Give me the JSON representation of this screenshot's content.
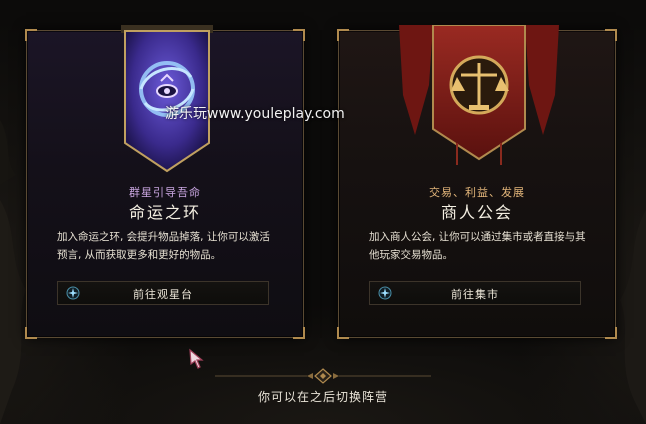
{
  "watermark": "游乐玩www.youleplay.com",
  "cards": [
    {
      "subtitle": "群星引导吾命",
      "title": "命运之环",
      "description": "加入命运之环, 会提升物品掉落, 让你可以激活预言, 从而获取更多和更好的物品。",
      "button_label": "前往观星台",
      "banner_icon": "eye-swirl-emblem-icon",
      "button_icon": "compass-star-icon",
      "accent": "#c9a6e0"
    },
    {
      "subtitle": "交易、利益、发展",
      "title": "商人公会",
      "description": "加入商人公会, 让你可以通过集市或者直接与其他玩家交易物品。",
      "button_label": "前往集市",
      "banner_icon": "scales-emblem-icon",
      "button_icon": "compass-star-icon",
      "accent": "#e2b57a"
    }
  ],
  "footer_note": "你可以在之后切换阵营",
  "colors": {
    "gold_trim": "#b08a4e",
    "purple_banner": "#3a2a8c",
    "red_banner": "#7a1a16"
  }
}
